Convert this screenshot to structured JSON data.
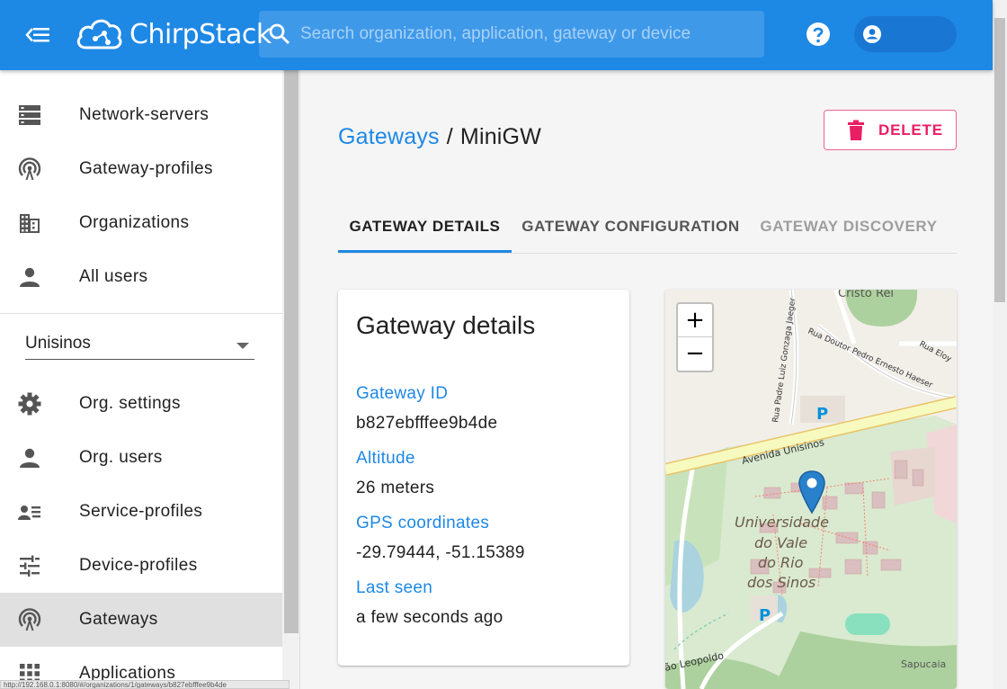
{
  "header": {
    "brand": "ChirpStack",
    "search_placeholder": "Search organization, application, gateway or device",
    "colors": {
      "primary": "#1e88e5",
      "accent": "#e91e63"
    }
  },
  "sidebar": {
    "top_items": [
      {
        "label": "Network-servers",
        "icon": "server-icon"
      },
      {
        "label": "Gateway-profiles",
        "icon": "gateway-icon"
      },
      {
        "label": "Organizations",
        "icon": "building-icon"
      },
      {
        "label": "All users",
        "icon": "person-icon"
      }
    ],
    "org_select": {
      "value": "Unisinos"
    },
    "org_items": [
      {
        "label": "Org. settings",
        "icon": "gear-icon"
      },
      {
        "label": "Org. users",
        "icon": "person-icon"
      },
      {
        "label": "Service-profiles",
        "icon": "service-profile-icon"
      },
      {
        "label": "Device-profiles",
        "icon": "tune-icon"
      },
      {
        "label": "Gateways",
        "icon": "gateway-icon",
        "active": true
      },
      {
        "label": "Applications",
        "icon": "apps-icon"
      }
    ],
    "status_url": "http://192.168.0.1:8080/#/organizations/1/gateways/b827ebfffee9b4de"
  },
  "main": {
    "breadcrumb": {
      "parent": "Gateways",
      "separator": "/",
      "current": "MiniGW"
    },
    "delete_label": "DELETE",
    "tabs": [
      {
        "label": "GATEWAY DETAILS",
        "state": "active"
      },
      {
        "label": "GATEWAY CONFIGURATION",
        "state": "normal"
      },
      {
        "label": "GATEWAY DISCOVERY",
        "state": "disabled"
      }
    ],
    "details": {
      "title": "Gateway details",
      "gateway_id_label": "Gateway ID",
      "gateway_id": "b827ebfffee9b4de",
      "altitude_label": "Altitude",
      "altitude": "26 meters",
      "gps_label": "GPS coordinates",
      "gps": "-29.79444, -51.15389",
      "last_seen_label": "Last seen",
      "last_seen": "a few seconds ago"
    },
    "map": {
      "zoom_in": "+",
      "zoom_out": "−",
      "labels": {
        "cristo_rei": "Cristo Rei",
        "street1": "Rua Padre Luiz Gonzaga Jaeger",
        "street2": "Rua Doutor Pedro Ernesto Haeser",
        "street3": "Rua Eloy",
        "street4": "Rua Padre Luiz Gonzaga Jaeger",
        "avenida": "Avenida Unisinos",
        "parking": "P",
        "campus_line1": "Universidade",
        "campus_line2": "do Vale",
        "campus_line3": "do Rio",
        "campus_line4": "dos Sinos",
        "leopoldo": "ão Leopoldo",
        "sapucaia": "Sapucaia"
      }
    }
  }
}
